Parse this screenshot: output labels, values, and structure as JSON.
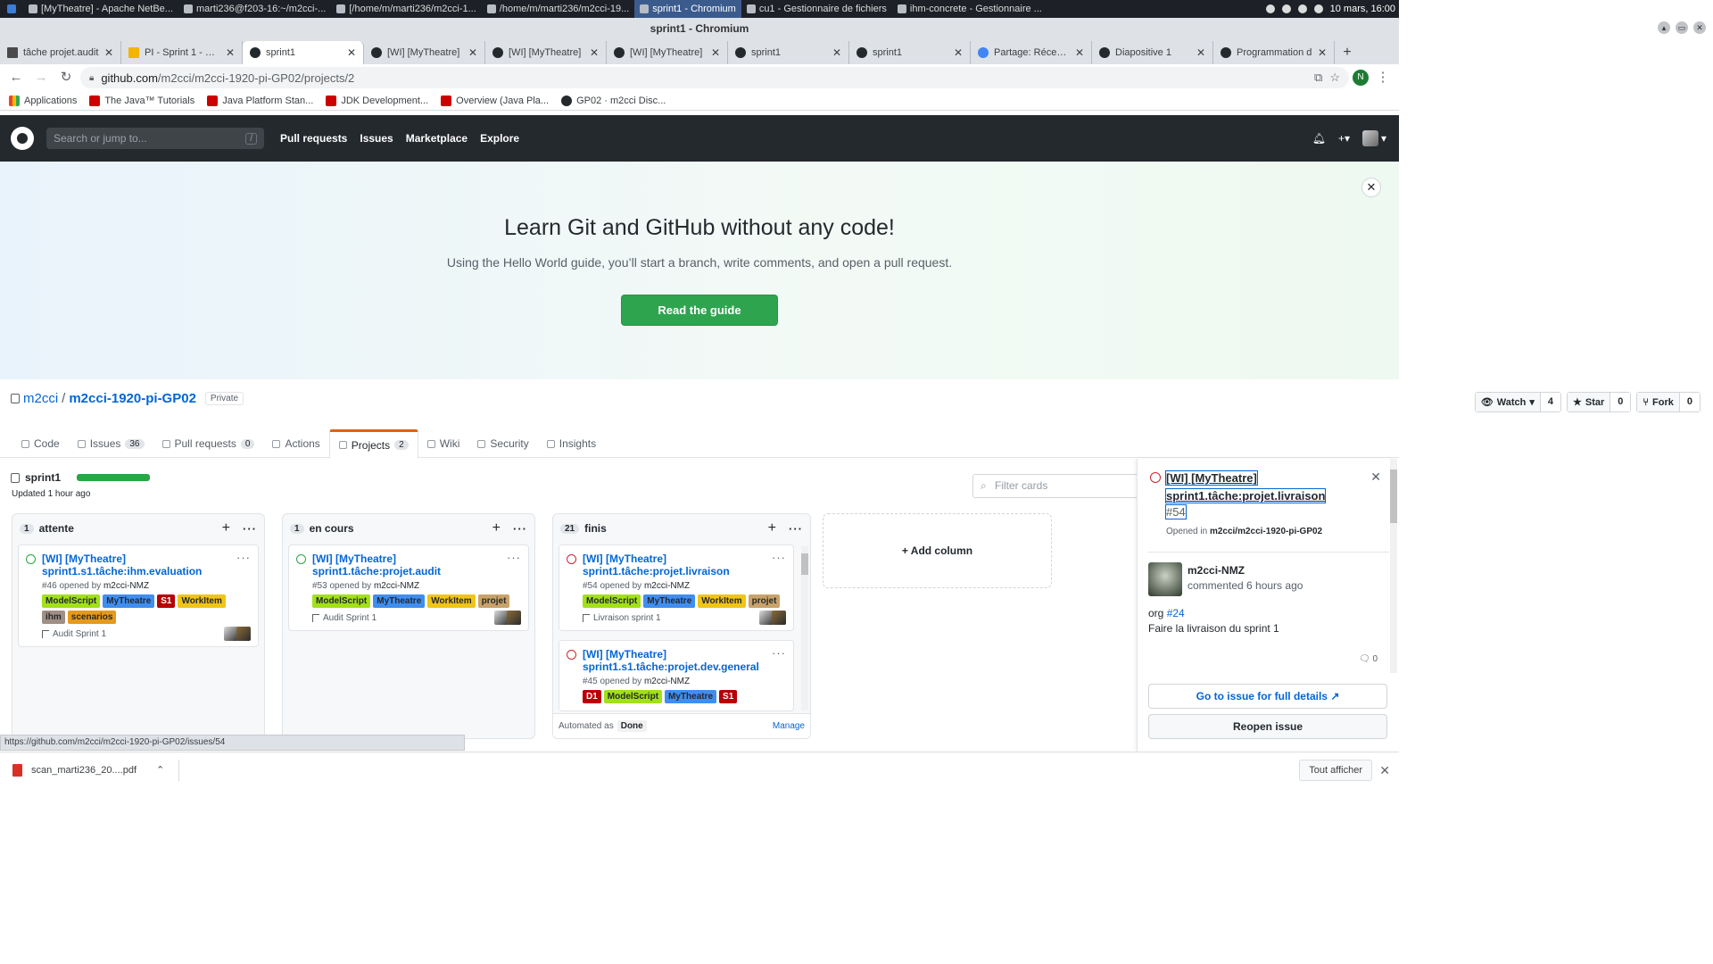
{
  "taskbar": {
    "items": [
      {
        "label": "[MyTheatre] - Apache NetBe..."
      },
      {
        "label": "marti236@f203-16:~/m2cci-..."
      },
      {
        "label": "[/home/m/marti236/m2cci-1..."
      },
      {
        "label": "/home/m/marti236/m2cci-19..."
      },
      {
        "label": "sprint1 - Chromium",
        "active": true
      },
      {
        "label": "cu1 - Gestionnaire de fichiers"
      },
      {
        "label": "ihm-concrete - Gestionnaire ..."
      }
    ],
    "clock": "10 mars, 16:00"
  },
  "window": {
    "title": "sprint1 - Chromium"
  },
  "tabs": [
    {
      "label": "tâche projet.audit",
      "icon": "doc"
    },
    {
      "label": "PI - Sprint 1 - Goo",
      "icon": "slides"
    },
    {
      "label": "sprint1",
      "icon": "github",
      "active": true
    },
    {
      "label": "[WI] [MyTheatre]",
      "icon": "github"
    },
    {
      "label": "[WI] [MyTheatre]",
      "icon": "github"
    },
    {
      "label": "[WI] [MyTheatre]",
      "icon": "github"
    },
    {
      "label": "sprint1",
      "icon": "github"
    },
    {
      "label": "sprint1",
      "icon": "github"
    },
    {
      "label": "Partage: Réception",
      "icon": "g"
    },
    {
      "label": "Diapositive 1",
      "icon": "globe"
    },
    {
      "label": "Programmation d",
      "icon": "globe"
    }
  ],
  "url": {
    "host": "github.com",
    "path": "/m2cci/m2cci-1920-pi-GP02/projects/2"
  },
  "profile_initial": "N",
  "bookmarks": [
    {
      "label": "Applications",
      "icon": "grid"
    },
    {
      "label": "The Java™ Tutorials",
      "icon": "oracle"
    },
    {
      "label": "Java Platform Stan...",
      "icon": "oracle"
    },
    {
      "label": "JDK Development...",
      "icon": "oracle"
    },
    {
      "label": "Overview (Java Pla...",
      "icon": "oracle"
    },
    {
      "label": "GP02 · m2cci Disc...",
      "icon": "github"
    }
  ],
  "github": {
    "search_placeholder": "Search or jump to...",
    "search_shortcut": "/",
    "nav": [
      "Pull requests",
      "Issues",
      "Marketplace",
      "Explore"
    ]
  },
  "banner": {
    "title": "Learn Git and GitHub without any code!",
    "subtitle": "Using the Hello World guide, you’ll start a branch, write comments, and open a pull request.",
    "button": "Read the guide"
  },
  "repo": {
    "owner": "m2cci",
    "separator": "/",
    "name": "m2cci-1920-pi-GP02",
    "visibility": "Private",
    "watch": {
      "label": "Watch",
      "count": "4"
    },
    "star": {
      "label": "Star",
      "count": "0"
    },
    "fork": {
      "label": "Fork",
      "count": "0"
    }
  },
  "repo_tabs": [
    {
      "label": "Code"
    },
    {
      "label": "Issues",
      "count": "36"
    },
    {
      "label": "Pull requests",
      "count": "0"
    },
    {
      "label": "Actions"
    },
    {
      "label": "Projects",
      "count": "2",
      "active": true
    },
    {
      "label": "Wiki"
    },
    {
      "label": "Security"
    },
    {
      "label": "Insights"
    }
  ],
  "board": {
    "name": "sprint1",
    "updated": "Updated 1 hour ago",
    "progress_fraction": 1.0,
    "filter_placeholder": "Filter cards",
    "add_column": "+ Add column"
  },
  "columns": [
    {
      "count": "1",
      "name": "attente",
      "cards": [
        {
          "title": "[WI] [MyTheatre] sprint1.s1.tâche:ihm.evaluation",
          "number": "#46 opened by",
          "author": "m2cci-NMZ",
          "labels": [
            {
              "text": "ModelScript",
              "color": "#a2e01a"
            },
            {
              "text": "MyTheatre",
              "color": "#3f8ef0"
            },
            {
              "text": "S1",
              "color": "#b60205",
              "fg": "#ffffff"
            },
            {
              "text": "WorkItem",
              "color": "#f0c419"
            },
            {
              "text": "ihm",
              "color": "#a08f85"
            },
            {
              "text": "scenarios",
              "color": "#e69a1b"
            }
          ],
          "milestone": "Audit Sprint 1",
          "state": "open"
        }
      ]
    },
    {
      "count": "1",
      "name": "en cours",
      "cards": [
        {
          "title": "[WI] [MyTheatre] sprint1.tâche:projet.audit",
          "number": "#53 opened by",
          "author": "m2cci-NMZ",
          "labels": [
            {
              "text": "ModelScript",
              "color": "#a2e01a"
            },
            {
              "text": "MyTheatre",
              "color": "#3f8ef0"
            },
            {
              "text": "WorkItem",
              "color": "#f0c419"
            },
            {
              "text": "projet",
              "color": "#c9a36a"
            }
          ],
          "milestone": "Audit Sprint 1",
          "state": "open"
        }
      ]
    },
    {
      "count": "21",
      "name": "finis",
      "cards": [
        {
          "title": "[WI] [MyTheatre] sprint1.tâche:projet.livraison",
          "number": "#54 opened by",
          "author": "m2cci-NMZ",
          "labels": [
            {
              "text": "ModelScript",
              "color": "#a2e01a"
            },
            {
              "text": "MyTheatre",
              "color": "#3f8ef0"
            },
            {
              "text": "WorkItem",
              "color": "#f0c419"
            },
            {
              "text": "projet",
              "color": "#c9a36a"
            }
          ],
          "milestone": "Livraison sprint 1",
          "state": "closed"
        },
        {
          "title": "[WI] [MyTheatre] sprint1.s1.tâche:projet.dev.general",
          "number": "#45 opened by",
          "author": "m2cci-NMZ",
          "labels": [
            {
              "text": "D1",
              "color": "#b60205",
              "fg": "#ffffff"
            },
            {
              "text": "ModelScript",
              "color": "#a2e01a"
            },
            {
              "text": "MyTheatre",
              "color": "#3f8ef0"
            },
            {
              "text": "S1",
              "color": "#b60205",
              "fg": "#ffffff"
            }
          ],
          "milestone": "",
          "state": "closed"
        }
      ],
      "footer": {
        "automated": "Automated as",
        "value": "Done",
        "manage": "Manage"
      }
    }
  ],
  "side_panel": {
    "title": "[WI] [MyTheatre] sprint1.tâche:projet.livraison",
    "number": "#54",
    "opened_prefix": "Opened in",
    "opened_repo": "m2cci/m2cci-1920-pi-GP02",
    "commenter": "m2cci-NMZ",
    "comment_time": "commented 6 hours ago",
    "body_prefix": "org",
    "body_link": "#24",
    "body_line2": "Faire la livraison du sprint 1",
    "comment_count": "0",
    "goto_button": "Go to issue for full details",
    "reopen_button": "Reopen issue"
  },
  "status_url": "https://github.com/m2cci/m2cci-1920-pi-GP02/issues/54",
  "download": {
    "filename": "scan_marti236_20....pdf",
    "show_all": "Tout afficher"
  }
}
